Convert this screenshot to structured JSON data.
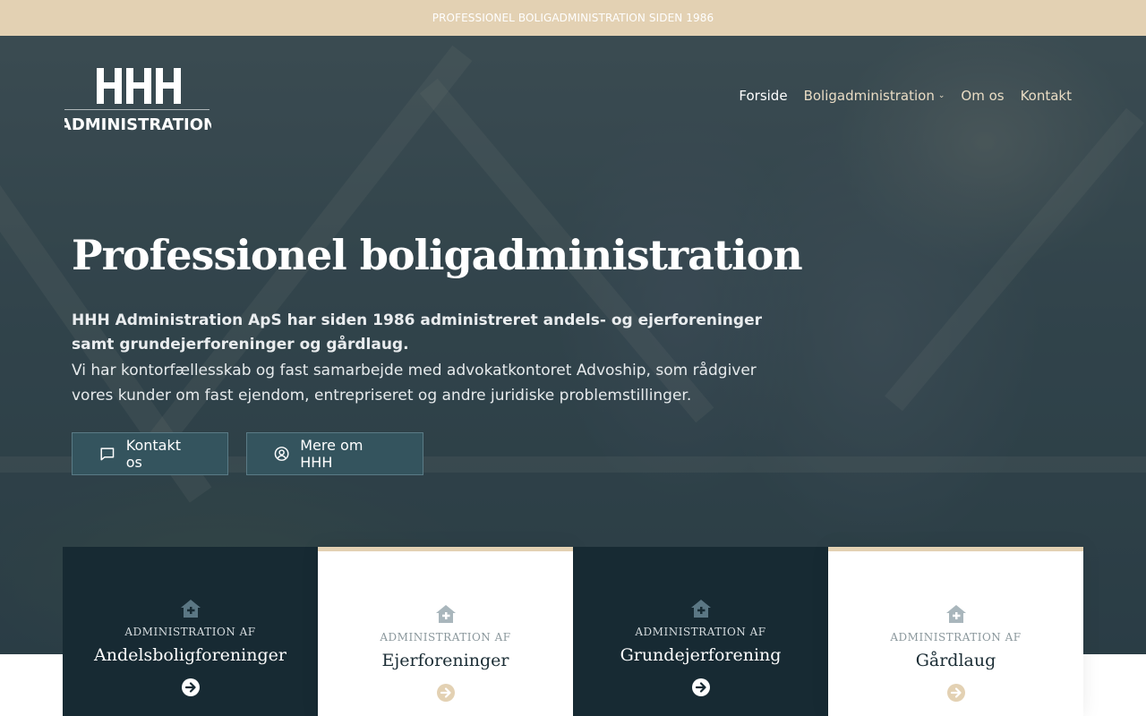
{
  "topbar": {
    "text": "PROFESSIONEL BOLIGADMINISTRATION SIDEN 1986"
  },
  "logo": {
    "mark": "HHH",
    "wordmark": "ADMINISTRATION"
  },
  "nav": {
    "items": [
      {
        "label": "Forside",
        "active": true
      },
      {
        "label": "Boligadministration",
        "has_dropdown": true
      },
      {
        "label": "Om os"
      },
      {
        "label": "Kontakt"
      }
    ]
  },
  "hero": {
    "title": "Professionel boligadministration",
    "lead": "HHH Administration ApS har siden 1986 administreret andels- og ejerforeninger samt grundejerforeninger og gårdlaug.",
    "text": "Vi har kontorfællesskab og fast samarbejde med advokatkontoret Advoship, som rådgiver vores kunder om fast ejendom, entrepriseret og andre juridiske problemstillinger.",
    "buttons": [
      {
        "label": "Kontakt os",
        "icon": "chat-icon"
      },
      {
        "label": "Mere om HHH",
        "icon": "user-circle-icon"
      }
    ]
  },
  "cards": [
    {
      "small": "ADMINISTRATION AF",
      "title": "Andelsboligforeninger",
      "style": "dark"
    },
    {
      "small": "ADMINISTRATION AF",
      "title": "Ejerforeninger",
      "style": "light"
    },
    {
      "small": "ADMINISTRATION AF",
      "title": "Grundejerforening",
      "style": "dark"
    },
    {
      "small": "ADMINISTRATION AF",
      "title": "Gårdlaug",
      "style": "light"
    }
  ],
  "colors": {
    "topbar": "#e3d1b3",
    "accent_gold": "#e3d1b3",
    "dark_card": "#172a33",
    "button": "#34545e"
  }
}
